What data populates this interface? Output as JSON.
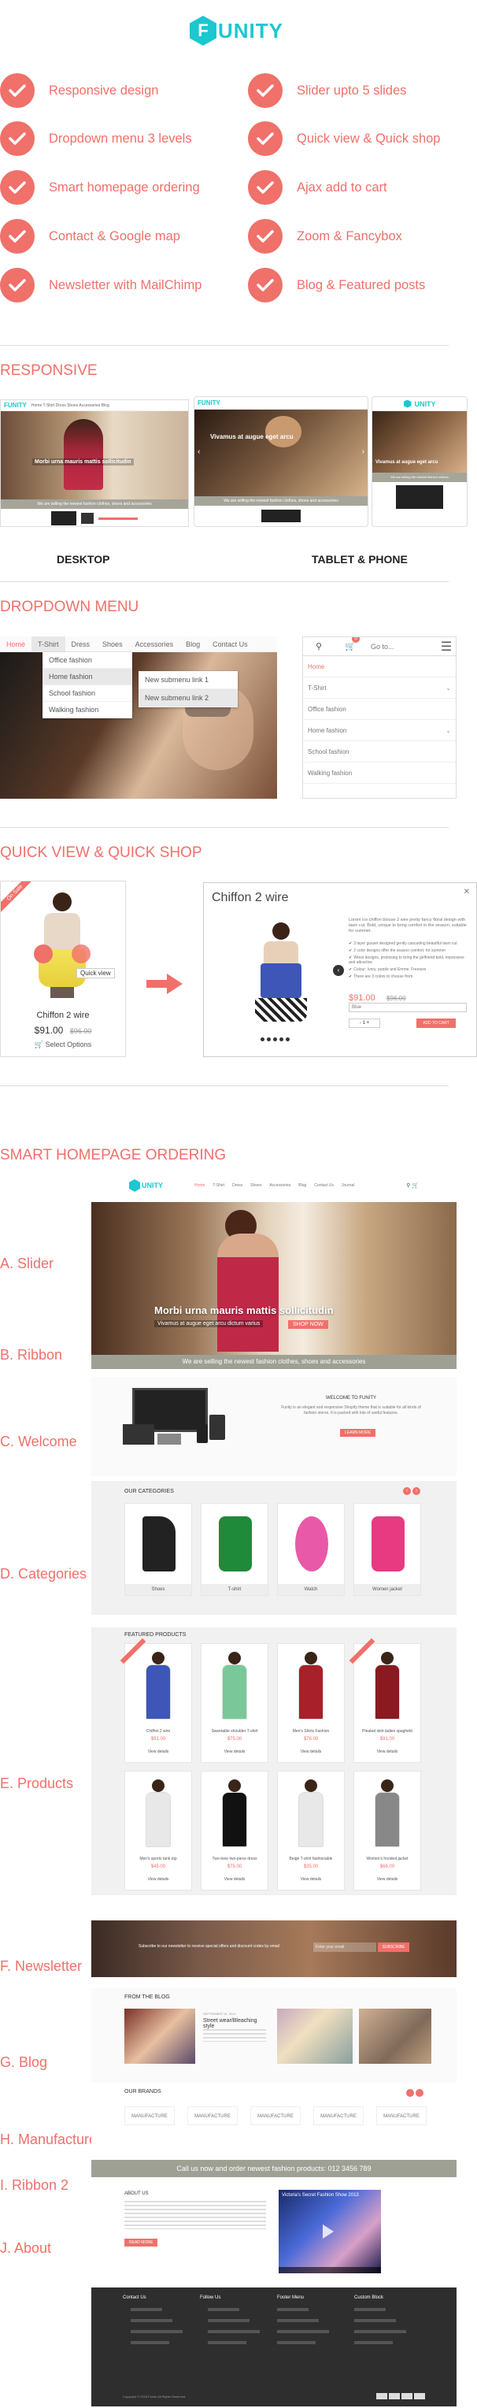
{
  "header": {
    "logo_letter": "F",
    "logo_text": "UNITY"
  },
  "features": {
    "left": [
      "Responsive design",
      "Dropdown menu 3 levels",
      "Smart homepage ordering",
      "Contact & Google map",
      "Newsletter with MailChimp"
    ],
    "right": [
      "Slider upto 5 slides",
      "Quick view & Quick shop",
      "Ajax add to cart",
      "Zoom & Fancybox",
      "Blog & Featured posts"
    ]
  },
  "responsive": {
    "title": "RESPONSIVE",
    "desktop_label": "DESKTOP",
    "tablet_label": "TABLET & PHONE",
    "slide_caption": "Morbi urna mauris mattis sollicitudin",
    "slide_caption2": "Vivamus at augue eget arcu",
    "ribbon": "We are selling the newest fashion clothes, shoes and accessories"
  },
  "dropdown": {
    "title": "DROPDOWN MENU",
    "nav": [
      "Home",
      "T-Shirt",
      "Dress",
      "Shoes",
      "Accessories",
      "Blog",
      "Contact Us"
    ],
    "sub1": [
      "Office fashion",
      "Home fashion",
      "School fashion",
      "Walking fashion"
    ],
    "sub2": [
      "New submenu link 1",
      "New submenu link 2"
    ],
    "mobile_goto": "Go to...",
    "mobile_items": [
      "Home",
      "T-Shirt",
      "Office fashion",
      "Home fashion",
      "School fashion",
      "Walking fashion"
    ],
    "cart_count": "0"
  },
  "quickview": {
    "title": "QUICK VIEW & QUICK SHOP",
    "badge": "On Sale",
    "quick_view": "Quick view",
    "product_name": "Chiffon 2 wire",
    "price": "$91.00",
    "old_price": "$96.00",
    "select_options": "Select Options",
    "desc": "Lorem ice chiffon blouse 2 wire pretty fancy floral design with lawn cut. Bold, unique to bring comfort in the season, suitable for summer.",
    "bullets": [
      "3 layer gusset designed gently cascading beautiful lawn cut",
      "2 color designs offer the season comfort, for summer",
      "Wrest designs, promising to bring the girlfriend bold, impressive and attractive",
      "Colour: Ivory, purple and Emme. Freesize",
      "There are 3 colors to choose from"
    ],
    "modal_price": "$91.00",
    "modal_old": "$96.00",
    "size_label": "Blue",
    "qty": "1",
    "add_to_cart": "ADD TO CART"
  },
  "smart": {
    "title": "SMART HOMEPAGE ORDERING",
    "labels": [
      "A. Slider",
      "B. Ribbon",
      "C. Welcome",
      "D. Categories",
      "E. Products",
      "F. Newsletter",
      "G. Blog",
      "H. Manufactures",
      "I. Ribbon 2",
      "J. About"
    ],
    "nav": [
      "Home",
      "T-Shirt",
      "Dress",
      "Shoes",
      "Accessories",
      "Blog",
      "Contact Us",
      "Journal"
    ],
    "slider_caption": "Morbi urna mauris mattis sollicitudin",
    "slider_sub": "Vivamus at augue eget arcu dictum varius",
    "slider_btn": "SHOP NOW",
    "ribbon": "We are selling the newest fashion clothes, shoes and accessories",
    "welcome_title": "WELCOME TO FUNITY",
    "welcome_text": "Funity is an elegant and responsive Shopify theme that is suitable for all kinds of fashion stores. It is packed with lots of useful features.",
    "welcome_btn": "LEARN MORE",
    "cat_title": "OUR CATEGORIES",
    "categories": [
      "Shoes",
      "T-shirt",
      "Watch",
      "Women jacket"
    ],
    "featured_title": "FEATURED PRODUCTS",
    "products": [
      {
        "name": "Chiffon 2 wire",
        "price": "$91.00"
      },
      {
        "name": "Sweetable shoulder T-shirt",
        "price": "$75.00"
      },
      {
        "name": "Men's Shirts Fashion",
        "price": "$78.00"
      },
      {
        "name": "Pleated skirt ladies spaghetti",
        "price": "$91.00"
      },
      {
        "name": "Men's sports tank top",
        "price": "$45.00"
      },
      {
        "name": "Two-tone two-piece dress",
        "price": "$75.00"
      },
      {
        "name": "Beige T-shirt fashionable",
        "price": "$35.00"
      },
      {
        "name": "Women's hooded jacket",
        "price": "$66.00"
      }
    ],
    "view_details": "View details",
    "newsletter_text": "Subscribe to our newsletter to receive special offers and discount codes by email",
    "newsletter_placeholder": "Enter your email",
    "newsletter_btn": "SUBSCRIBE",
    "blog_title": "FROM THE BLOG",
    "blog_post_title": "Street wear/Bleaching style",
    "blog_date": "SEPTEMBER 18, 2014",
    "brands_title": "OUR BRANDS",
    "brand": "MANUFACTURE",
    "ribbon2": "Call us now and order newest fashion products: 012 3456 789",
    "about_title": "ABOUT US",
    "about_btn": "READ MORE",
    "video_title": "Victoria's Secret Fashion Show 2013",
    "footer_cols": [
      "Contact Us",
      "Follow Us",
      "Footer Menu",
      "Custom Block"
    ],
    "footer_copy": "Copyright © 2015 Funity All Rights Reserved"
  }
}
